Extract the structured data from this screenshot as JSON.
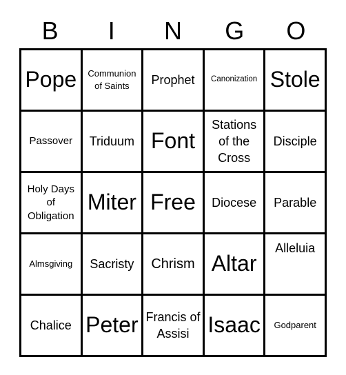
{
  "header": {
    "letters": [
      "B",
      "I",
      "N",
      "G",
      "O"
    ]
  },
  "cells": [
    "Pope",
    "Communion of Saints",
    "Prophet",
    "Canonization",
    "Stole",
    "Passover",
    "Triduum",
    "Font",
    "Stations of the Cross",
    "Disciple",
    "Holy Days of Obligation",
    "Miter",
    "Free",
    "Diocese",
    "Parable",
    "Almsgiving",
    "Sacristy",
    "Chrism",
    "Altar",
    "Alleluia",
    "Chalice",
    "Peter",
    "Francis of Assisi",
    "Isaac",
    "Godparent"
  ],
  "colors": {
    "line": "#000000",
    "background": "#ffffff",
    "text": "#000000"
  }
}
